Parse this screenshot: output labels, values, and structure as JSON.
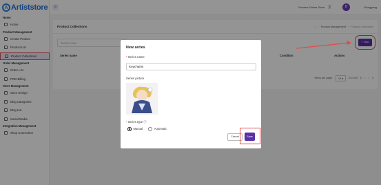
{
  "brand": {
    "name": "Artiststore",
    "mark": "A"
  },
  "topbar": {
    "preview_label": "Preview Online Store",
    "translate_glyph": "文",
    "avatar_initial": "B",
    "username": "Bongyang"
  },
  "sidebar": {
    "sections": [
      {
        "title": "Home",
        "items": [
          {
            "label": "Home",
            "active": false
          }
        ]
      },
      {
        "title": "Product Management",
        "items": [
          {
            "label": "Create Product",
            "active": false
          },
          {
            "label": "Product List",
            "active": false
          },
          {
            "label": "Product Collections",
            "active": true
          }
        ]
      },
      {
        "title": "Order Management",
        "items": [
          {
            "label": "Order List",
            "active": false
          },
          {
            "label": "POD Billing",
            "active": false
          }
        ]
      },
      {
        "title": "Store Management",
        "items": [
          {
            "label": "Store Design",
            "active": false
          },
          {
            "label": "Blog Categories",
            "active": false
          },
          {
            "label": "Blog List",
            "active": false
          },
          {
            "label": "Social Media",
            "active": false
          }
        ]
      },
      {
        "title": "Integration Management",
        "items": [
          {
            "label": "Shop Connection",
            "active": false
          }
        ]
      }
    ]
  },
  "page": {
    "title": "Product Collections",
    "breadcrumb": [
      "Product Management",
      "Product Collections"
    ],
    "search_placeholder": "Series name",
    "new_button": "+ New",
    "columns": [
      "Series name",
      "Condition",
      "Actions"
    ],
    "pager": {
      "items_per_page_label": "Items per page:",
      "per_page": "10",
      "range": "0-0 of 0"
    }
  },
  "modal": {
    "title": "New series",
    "series_name_label": "Series name",
    "series_name_value": "Keychains",
    "picture_label": "Series picture",
    "type_label": "Series type",
    "type_options": [
      {
        "label": "Manual",
        "selected": true
      },
      {
        "label": "Automatic",
        "selected": false
      }
    ],
    "cancel_label": "Cancel",
    "save_label": "Save"
  },
  "colors": {
    "accent": "#5a2fa8",
    "annotation": "#e24a4a",
    "brand": "#1f6fd6"
  }
}
